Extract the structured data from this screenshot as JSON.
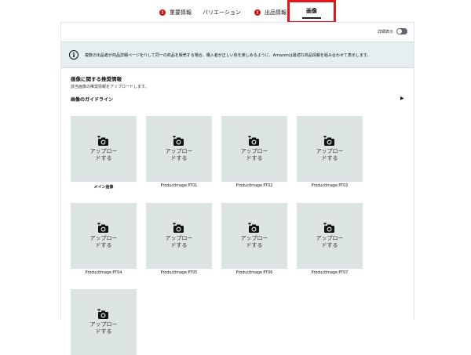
{
  "tabs": [
    {
      "label": "重要情報",
      "error": true
    },
    {
      "label": "バリエーション",
      "error": false
    },
    {
      "label": "出品情報",
      "error": true
    },
    {
      "label": "画像",
      "error": false,
      "active": true
    }
  ],
  "tab_error_glyph": "!",
  "toggle": {
    "label": "詳細表示",
    "on": false
  },
  "banner": {
    "icon": "info-icon",
    "text": "複数の出品者が商品詳細ページを介して同一の商品を販売する場合、購入者が正しい体を楽しめるように、Amazonは最適な商品情報を組み合わせて表示します。"
  },
  "info_glyph": "i",
  "section": {
    "title": "画像に関する推奨情報",
    "subtitle": "該当画像の推奨情報をアップロードします。",
    "guideline": "画像のガイドライン",
    "arrow": "▶"
  },
  "upload_text": "アップロードする",
  "slots": [
    {
      "label": "メイン画像"
    },
    {
      "label": "ProductImage PT01"
    },
    {
      "label": "ProductImage PT02"
    },
    {
      "label": "ProductImage PT03"
    },
    {
      "label": "ProductImage PT04"
    },
    {
      "label": "ProductImage PT05"
    },
    {
      "label": "ProductImage PT06"
    },
    {
      "label": "ProductImage PT07"
    },
    {
      "label": ""
    }
  ],
  "colors": {
    "accent_red": "#e4161b",
    "error_red": "#cc1818",
    "slot_bg": "#dde4e4",
    "banner_bg": "#e6efef"
  }
}
